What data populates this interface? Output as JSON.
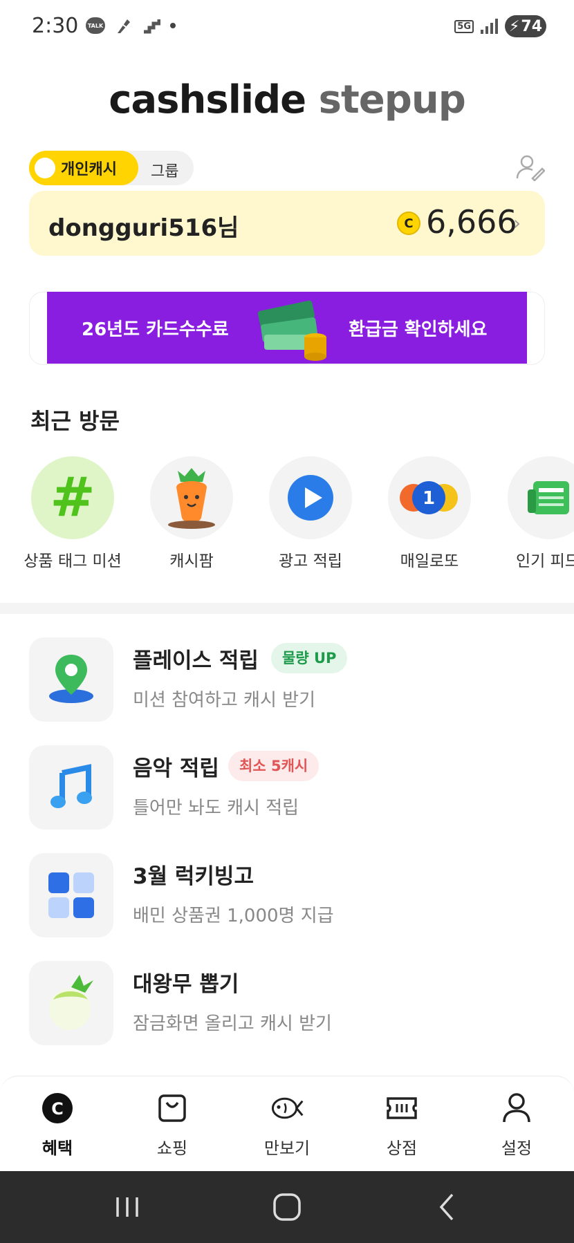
{
  "status_bar": {
    "time": "2:30",
    "talk_badge": "TALK",
    "network": "5G",
    "battery": "74"
  },
  "header": {
    "logo_primary": "cashslide",
    "logo_secondary": "stepup"
  },
  "account_toggle": {
    "personal": "개인캐시",
    "group": "그룹",
    "selected": "personal"
  },
  "balance": {
    "username": "dongguri516님",
    "coin_symbol": "C",
    "points": "6,666"
  },
  "banner": {
    "left_text": "26년도 카드수수료",
    "right_text": "환급금 확인하세요"
  },
  "recent": {
    "title": "최근 방문",
    "items": [
      {
        "label": "상품 태그 미션",
        "icon": "hashtag-icon"
      },
      {
        "label": "캐시팜",
        "icon": "carrot-icon"
      },
      {
        "label": "광고 적립",
        "icon": "play-icon"
      },
      {
        "label": "매일로또",
        "icon": "lotto-ball-icon"
      },
      {
        "label": "인기 피드",
        "icon": "newspaper-icon"
      }
    ]
  },
  "features": [
    {
      "title": "플레이스 적립",
      "badge": "물량 UP",
      "subtitle": "미션 참여하고 캐시 받기",
      "icon": "map-pin-icon"
    },
    {
      "title": "음악 적립",
      "badge": "최소 5캐시",
      "subtitle": "틀어만 놔도 캐시 적립",
      "icon": "music-note-icon"
    },
    {
      "title": "3월 럭키빙고",
      "badge": "",
      "subtitle": "배민 상품권 1,000명 지급",
      "icon": "bingo-grid-icon"
    },
    {
      "title": "대왕무 뽑기",
      "badge": "",
      "subtitle": "잠금화면 올리고 캐시 받기",
      "icon": "radish-icon"
    }
  ],
  "bottom_nav": {
    "items": [
      {
        "label": "혜택",
        "icon": "cash-coin-icon",
        "active": true
      },
      {
        "label": "쇼핑",
        "icon": "shopping-bag-icon",
        "active": false
      },
      {
        "label": "만보기",
        "icon": "fish-icon",
        "active": false
      },
      {
        "label": "상점",
        "icon": "ticket-icon",
        "active": false
      },
      {
        "label": "설정",
        "icon": "person-icon",
        "active": false
      }
    ]
  },
  "colors": {
    "brand_yellow": "#ffd400",
    "balance_bg": "#fff8cf",
    "banner_purple": "#8a1ee0",
    "badge_green": "#1d9a4a",
    "badge_red": "#e05555"
  }
}
